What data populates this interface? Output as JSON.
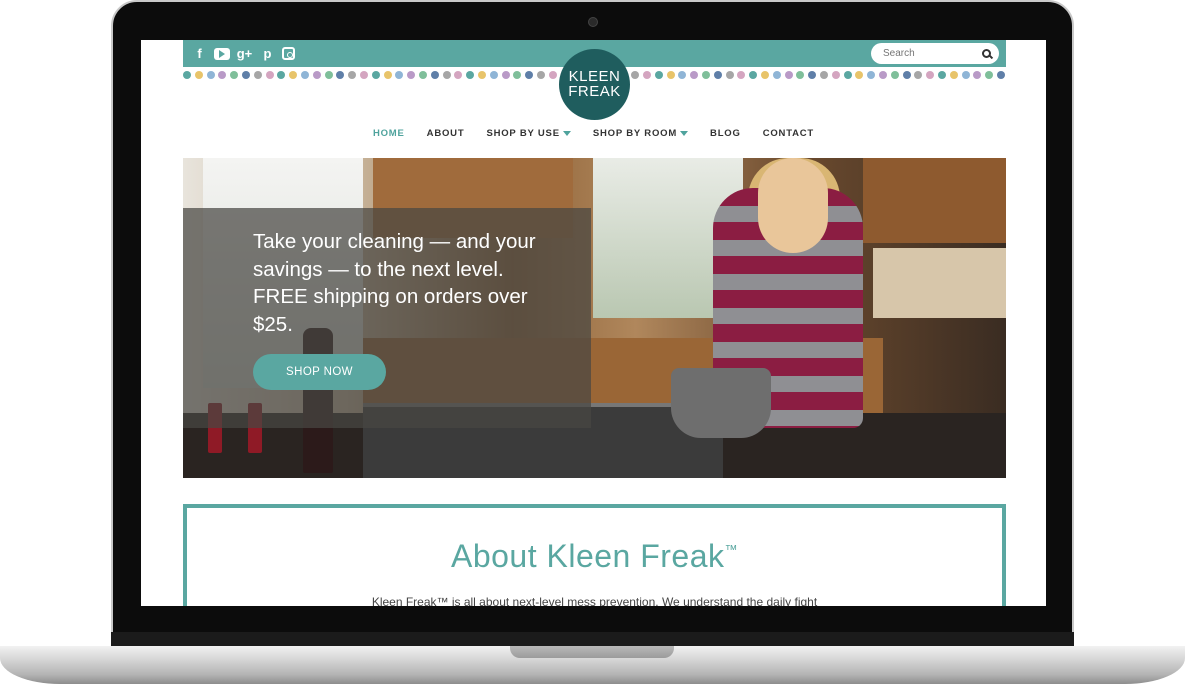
{
  "social": [
    "facebook-icon",
    "youtube-icon",
    "google-plus-icon",
    "pinterest-icon",
    "instagram-icon"
  ],
  "search": {
    "placeholder": "Search"
  },
  "logo": {
    "line1": "KLEEN",
    "line2": "FREAK"
  },
  "nav": {
    "items": [
      {
        "label": "HOME",
        "active": true,
        "dropdown": false
      },
      {
        "label": "ABOUT",
        "active": false,
        "dropdown": false
      },
      {
        "label": "SHOP BY USE",
        "active": false,
        "dropdown": true
      },
      {
        "label": "SHOP BY ROOM",
        "active": false,
        "dropdown": true
      },
      {
        "label": "BLOG",
        "active": false,
        "dropdown": false
      },
      {
        "label": "CONTACT",
        "active": false,
        "dropdown": false
      }
    ]
  },
  "hero": {
    "headline": "Take your cleaning — and your savings — to the next level. FREE shipping on orders over $25.",
    "button": "SHOP NOW"
  },
  "about": {
    "title": "About Kleen Freak",
    "tm": "™",
    "intro": "Kleen Freak™ is all about next-level mess prevention. We understand the daily fight"
  },
  "colors": {
    "accent": "#5aa7a1",
    "logo_bg": "#1f5d5e",
    "dots": [
      "#5aa7a1",
      "#e8c46a",
      "#8fb5d6",
      "#b99ac7",
      "#7fbf9a",
      "#5f7fa8",
      "#a6a6a6",
      "#d4a5c0"
    ]
  }
}
